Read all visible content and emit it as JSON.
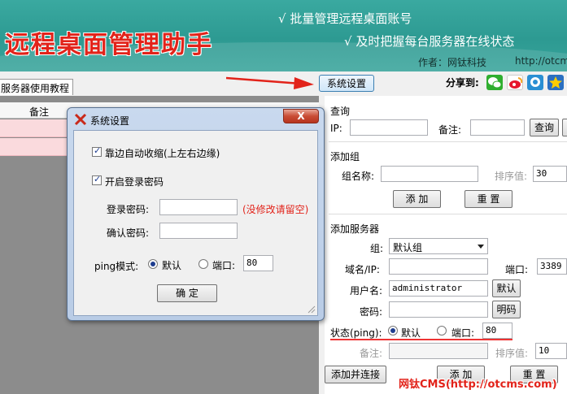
{
  "banner": {
    "title": "远程桌面管理助手",
    "slogan_1": "√ 批量管理远程桌面账号",
    "slogan_2": "√ 及时把握每台服务器在线状态",
    "author": "作者：网钛科技",
    "site": "http://otcm"
  },
  "toolbar": {
    "tutorial_tab": "服务器使用教程",
    "settings_button": "系统设置",
    "share_label": "分享到:",
    "share_icons": [
      "wechat-icon",
      "weibo-icon",
      "qzone-icon",
      "favorite-icon"
    ]
  },
  "server_list": {
    "column_note": "备注"
  },
  "query": {
    "title": "查询",
    "ip_label": "IP:",
    "ip_value": "",
    "note_label": "备注:",
    "note_value": "",
    "query_button": "查询"
  },
  "add_group": {
    "title": "添加组",
    "name_label": "组名称:",
    "name_value": "",
    "sort_label": "排序值:",
    "sort_value": "30",
    "add_button": "添 加",
    "reset_button": "重 置"
  },
  "add_server": {
    "title": "添加服务器",
    "group_label": "组:",
    "group_value": "默认组",
    "domain_label": "域名/IP:",
    "domain_value": "",
    "port_label": "端口:",
    "port_value": "3389",
    "user_label": "用户名:",
    "user_value": "administrator",
    "default_user_button": "默认",
    "password_label": "密码:",
    "password_value": "",
    "show_password_button": "明码",
    "status_label": "状态(ping):",
    "status_default_label": "默认",
    "status_port_label": "端口:",
    "status_port_value": "80",
    "note_label": "备注:",
    "note_value": "",
    "sort_label": "排序值:",
    "sort_value": "10",
    "add_connect_button": "添加并连接",
    "add_button": "添 加",
    "reset_button": "重 置"
  },
  "dialog": {
    "title": "系统设置",
    "close_label": "X",
    "dock_checkbox": "靠边自动收缩(上左右边缘)",
    "login_pwd_checkbox": "开启登录密码",
    "login_pwd_label": "登录密码:",
    "login_pwd_value": "",
    "no_change_hint": "(没修改请留空)",
    "confirm_pwd_label": "确认密码:",
    "confirm_pwd_value": "",
    "ping_label": "ping模式:",
    "ping_default_label": "默认",
    "ping_port_label": "端口:",
    "ping_port_value": "80",
    "ok_button": "确  定"
  },
  "watermark": "网钛CMS(http://otcms.com)",
  "colors": {
    "banner": "#2d9a92",
    "title_red": "#e2231a",
    "row_pink": "#fadadd",
    "dialog_frame": "#b9cce6"
  }
}
